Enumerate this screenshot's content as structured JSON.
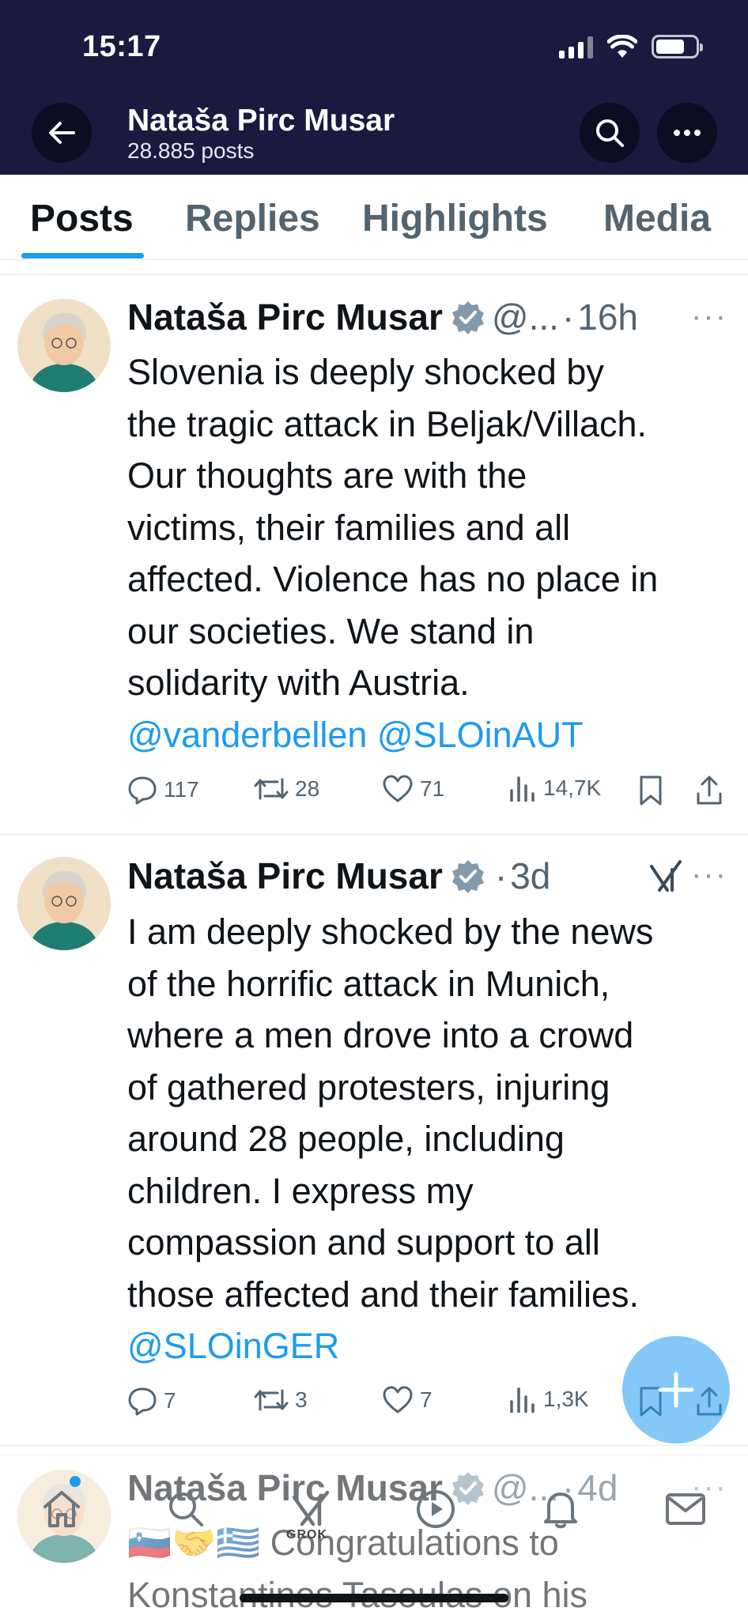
{
  "status_bar": {
    "time": "15:17"
  },
  "header": {
    "name": "Nataša Pirc Musar",
    "post_count": "28.885 posts"
  },
  "tabs": [
    {
      "label": "Posts",
      "active": true
    },
    {
      "label": "Replies",
      "active": false
    },
    {
      "label": "Highlights",
      "active": false
    },
    {
      "label": "Media",
      "active": false
    }
  ],
  "posts": [
    {
      "author": "Nataša Pirc Musar",
      "handle": "@...",
      "time": "16h",
      "text_lines": [
        "Slovenia is deeply shocked by",
        "the tragic attack in Beljak/Villach.",
        "Our thoughts are with the",
        "victims, their families and all",
        "affected. Violence has no place in",
        "our societies. We stand in",
        "solidarity with Austria."
      ],
      "mentions": "@vanderbellen @SLOinAUT",
      "replies": "117",
      "reposts": "28",
      "likes": "71",
      "views": "14,7K"
    },
    {
      "author": "Nataša Pirc Musar",
      "time": "3d",
      "text_lines": [
        "I am deeply shocked by the news",
        "of the horrific attack in Munich,",
        "where a men drove into a crowd",
        "of gathered protesters, injuring",
        "around 28 people, including",
        "children. I express my",
        "compassion and support to all",
        "those affected and their families."
      ],
      "mentions": "@SLOinGER",
      "replies": "7",
      "reposts": "3",
      "likes": "7",
      "views": "1,3K"
    },
    {
      "author": "Nataša Pirc Musar",
      "handle": "@...",
      "time": "4d",
      "flags": "🇸🇮🤝🇬🇷",
      "text_lines": [
        "Congratulations to",
        "Konstantinos Tasoulas on his"
      ]
    }
  ],
  "bottom_nav": {
    "grok_label": "GROK"
  },
  "colors": {
    "header_bg": "#1a1a40",
    "accent": "#1d9bf0",
    "text": "#0f1419",
    "secondary": "#536471"
  },
  "icons": [
    "back-arrow-icon",
    "search-icon",
    "more-icon",
    "verified-badge-icon",
    "reply-icon",
    "repost-icon",
    "like-icon",
    "views-icon",
    "bookmark-icon",
    "share-icon",
    "compose-plus-icon",
    "home-icon",
    "grok-icon",
    "video-icon",
    "bell-icon",
    "mail-icon"
  ]
}
